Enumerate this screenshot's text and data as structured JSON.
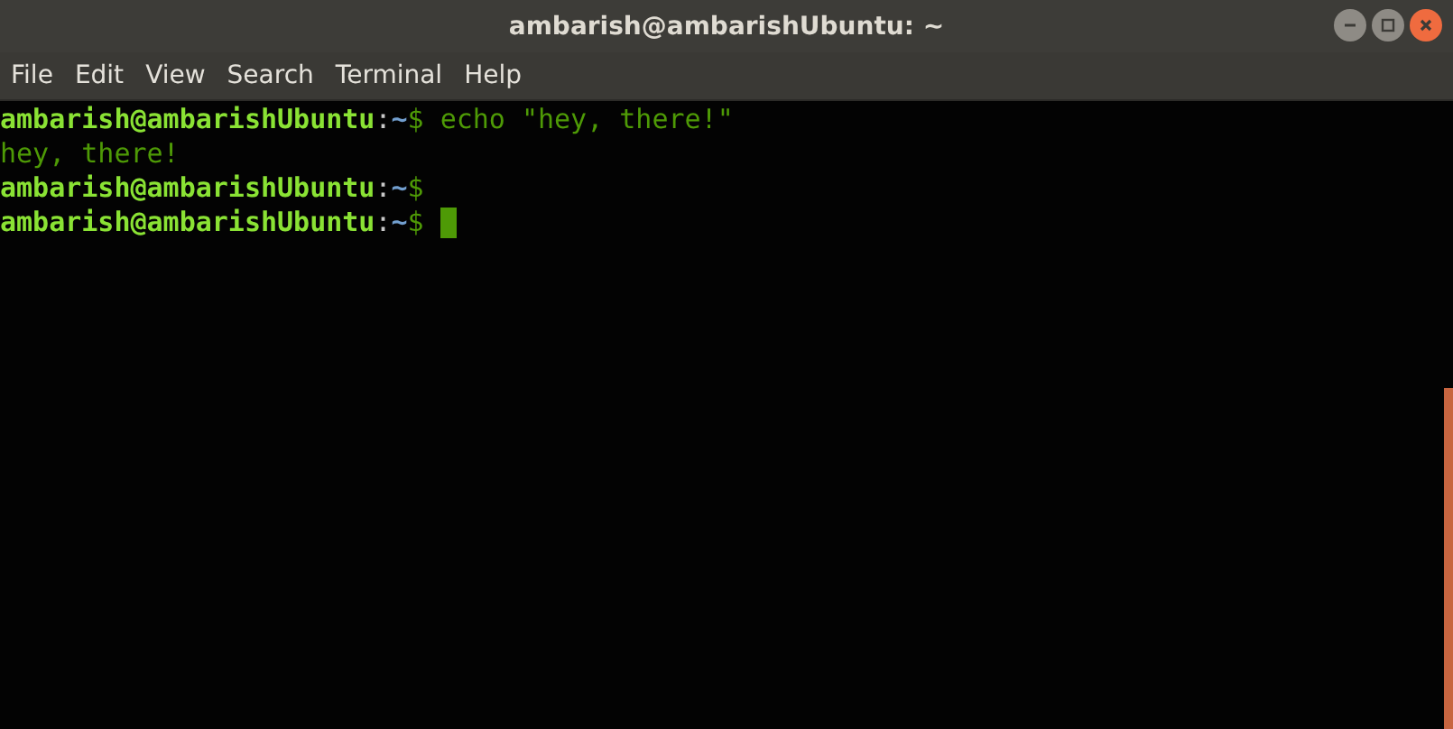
{
  "window": {
    "title": "ambarish@ambarishUbuntu: ~"
  },
  "menu": [
    "File",
    "Edit",
    "View",
    "Search",
    "Terminal",
    "Help"
  ],
  "terminal": {
    "lines": [
      {
        "kind": "prompt",
        "user": "ambarish@ambarishUbuntu",
        "separator": ":",
        "path": "~",
        "sign": "$",
        "command": "echo \"hey, there!\"",
        "cursor": false
      },
      {
        "kind": "output",
        "text": "hey, there!"
      },
      {
        "kind": "prompt",
        "user": "ambarish@ambarishUbuntu",
        "separator": ":",
        "path": "~",
        "sign": "$",
        "cursor": false
      },
      {
        "kind": "prompt",
        "user": "ambarish@ambarishUbuntu",
        "separator": ":",
        "path": "~",
        "sign": "$",
        "cursor": true
      }
    ]
  }
}
